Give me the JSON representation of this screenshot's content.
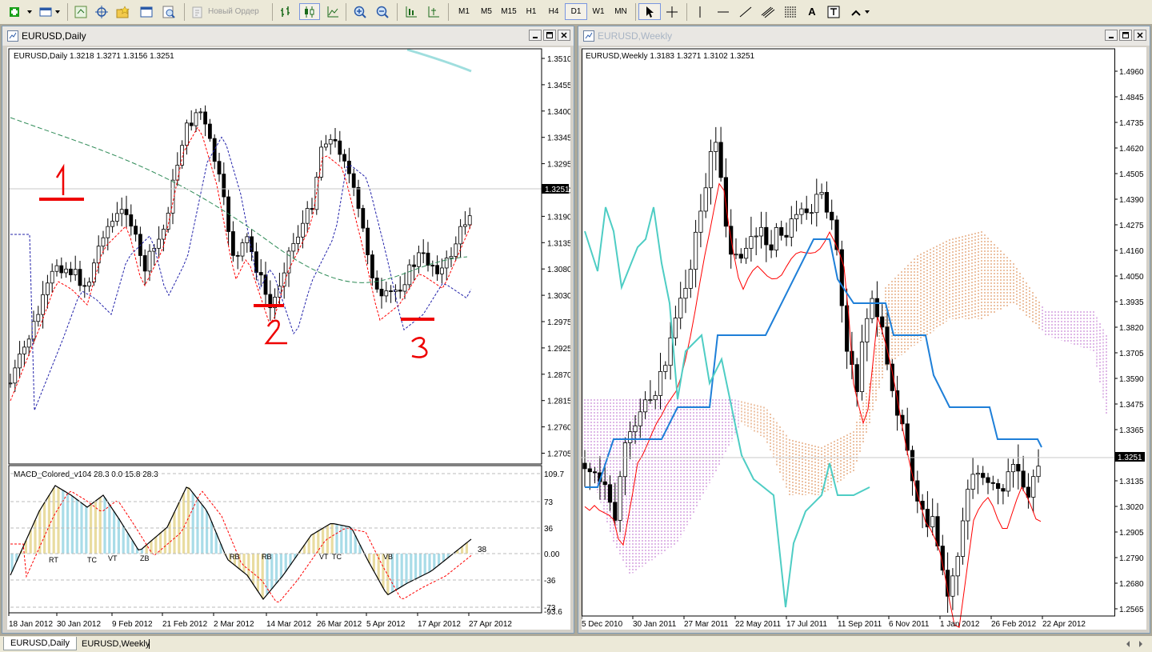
{
  "toolbar": {
    "new_order": "Новый Ордер",
    "timeframes": [
      "M1",
      "M5",
      "M15",
      "H1",
      "H4",
      "D1",
      "W1",
      "MN"
    ],
    "active_timeframe": "D1",
    "text_tool": "A"
  },
  "daily": {
    "window_title": "EURUSD,Daily",
    "info": "EURUSD,Daily  1.3218 1.3271 1.3156 1.3251",
    "price_ticks": [
      "1.3510",
      "1.3455",
      "1.3400",
      "1.3345",
      "1.3295",
      "1.3240",
      "1.3190",
      "1.3135",
      "1.3080",
      "1.3030",
      "1.2975",
      "1.2925",
      "1.2870",
      "1.2815",
      "1.2760",
      "1.2705"
    ],
    "last_price": "1.3251",
    "date_ticks": [
      "18 Jan 2012",
      "30 Jan 2012",
      "9 Feb 2012",
      "21 Feb 2012",
      "2 Mar 2012",
      "14 Mar 2012",
      "26 Mar 2012",
      "5 Apr 2012",
      "17 Apr 2012",
      "27 Apr 2012"
    ],
    "annotations": [
      "1",
      "2",
      "3"
    ],
    "macd": {
      "info": "MACD_Colored_v104 28.3 0.0 15.8 28.3",
      "ticks": [
        "109.7",
        "73",
        "36",
        "0.00",
        "-36",
        "-73",
        "-93.6"
      ],
      "value_label": "38",
      "signals": [
        "RT",
        "TC",
        "VT",
        "ZB",
        "RB",
        "RB",
        "VT",
        "TC",
        "VB"
      ]
    }
  },
  "weekly": {
    "window_title": "EURUSD,Weekly",
    "info": "EURUSD,Weekly  1.3183 1.3271 1.3102 1.3251",
    "price_ticks": [
      "1.4960",
      "1.4845",
      "1.4735",
      "1.4620",
      "1.4505",
      "1.4390",
      "1.4275",
      "1.4160",
      "1.4050",
      "1.3935",
      "1.3820",
      "1.3705",
      "1.3590",
      "1.3475",
      "1.3365",
      "1.3251",
      "1.3135",
      "1.3020",
      "1.2905",
      "1.2790",
      "1.2680",
      "1.2565"
    ],
    "last_price": "1.3251",
    "date_ticks": [
      "5 Dec 2010",
      "30 Jan 2011",
      "27 Mar 2011",
      "22 May 2011",
      "17 Jul 2011",
      "11 Sep 2011",
      "6 Nov 2011",
      "1 Jan 2012",
      "26 Feb 2012",
      "22 Apr 2012"
    ]
  },
  "tabs": [
    "EURUSD,Daily",
    "EURUSD,Weekly"
  ],
  "colors": {
    "bull": "#ffffff",
    "bear": "#000000",
    "red": "#ff0000",
    "teal": "#4ecdc4",
    "blue": "#1e7fd8",
    "green": "#2e8b57",
    "macd_up": "#e9dca0",
    "macd_dn": "#a9dce8"
  }
}
